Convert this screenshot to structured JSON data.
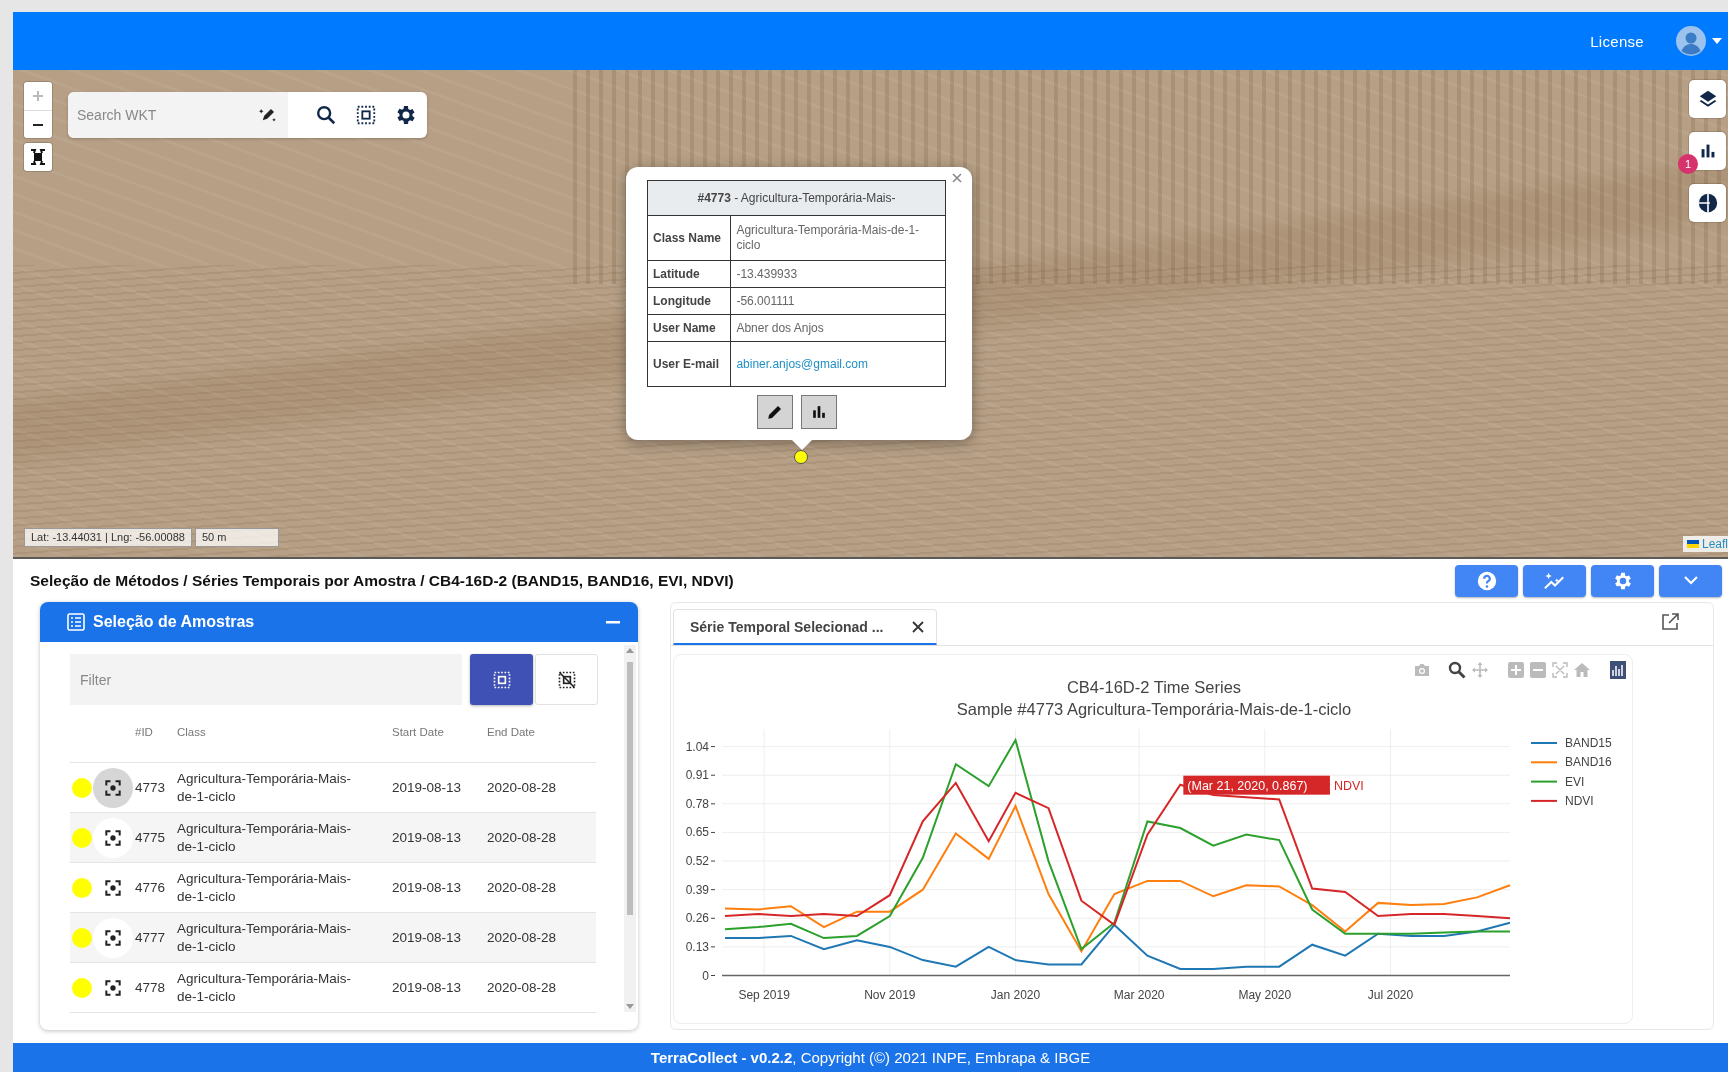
{
  "header": {
    "license_link": "License"
  },
  "map": {
    "search": {
      "placeholder": "Search WKT"
    },
    "zoom_in_disabled": true,
    "badge": "1",
    "popup": {
      "title": "**#4773** - Agricultura-Temporária-Mais-",
      "fields": [
        {
          "label": "Class Name",
          "value": "Agricultura-Temporária-Mais-de-1-ciclo",
          "kind": "text"
        },
        {
          "label": "Latitude",
          "value": "-13.439933",
          "kind": "text"
        },
        {
          "label": "Longitude",
          "value": "-56.001111",
          "kind": "text"
        },
        {
          "label": "User Name",
          "value": "Abner dos Anjos",
          "kind": "text"
        },
        {
          "label": "User E-mail",
          "value": "abiner.anjos@gmail.com",
          "kind": "link"
        }
      ]
    },
    "coordinates": "Lat: -13.44031 | Lng: -56.00088",
    "scale": "50 m",
    "attribution": "Leafl"
  },
  "breadcrumb": "Seleção de Métodos / Séries Temporais por Amostra / CB4-16D-2 (BAND15, BAND16, EVI, NDVI)",
  "samples": {
    "title": "Seleção de Amostras",
    "filter": {
      "placeholder": "Filter"
    },
    "columns": [
      "#ID",
      "Class",
      "Start Date",
      "End Date"
    ],
    "rows": [
      {
        "id": "4773",
        "class": "Agricultura-Temporária-Mais-de-1-ciclo",
        "start": "2019-08-13",
        "end": "2020-08-28",
        "color": "#ffff00",
        "selected": true
      },
      {
        "id": "4775",
        "class": "Agricultura-Temporária-Mais-de-1-ciclo",
        "start": "2019-08-13",
        "end": "2020-08-28",
        "color": "#ffff00",
        "selected": false
      },
      {
        "id": "4776",
        "class": "Agricultura-Temporária-Mais-de-1-ciclo",
        "start": "2019-08-13",
        "end": "2020-08-28",
        "color": "#ffff00",
        "selected": false
      },
      {
        "id": "4777",
        "class": "Agricultura-Temporária-Mais-de-1-ciclo",
        "start": "2019-08-13",
        "end": "2020-08-28",
        "color": "#ffff00",
        "selected": false
      },
      {
        "id": "4778",
        "class": "Agricultura-Temporária-Mais-de-1-ciclo",
        "start": "2019-08-13",
        "end": "2020-08-28",
        "color": "#ffff00",
        "selected": false
      }
    ]
  },
  "timeseries": {
    "tabs": [
      {
        "label": "Série Temporal Selecionad ...",
        "selected": true
      }
    ],
    "subtitle": "Sample #4773 Agricultura-Temporária-Mais-de-1-ciclo",
    "chart_data": {
      "type": "line",
      "title": "CB4-16D-2 Time Series",
      "x": [
        "2019-08-13",
        "2019-08-29",
        "2019-09-14",
        "2019-09-30",
        "2019-10-16",
        "2019-11-01",
        "2019-11-17",
        "2019-12-03",
        "2019-12-19",
        "2020-01-01",
        "2020-01-17",
        "2020-02-02",
        "2020-02-18",
        "2020-03-05",
        "2020-03-21",
        "2020-04-06",
        "2020-04-22",
        "2020-05-08",
        "2020-05-24",
        "2020-06-09",
        "2020-06-25",
        "2020-07-11",
        "2020-07-27",
        "2020-08-12",
        "2020-08-28"
      ],
      "series": [
        {
          "name": "BAND15",
          "color": "#1f77b4",
          "values": [
            0.17,
            0.17,
            0.18,
            0.12,
            0.16,
            0.13,
            0.07,
            0.04,
            0.13,
            0.07,
            0.05,
            0.05,
            0.23,
            0.09,
            0.03,
            0.03,
            0.04,
            0.04,
            0.14,
            0.09,
            0.19,
            0.18,
            0.18,
            0.2,
            0.24
          ]
        },
        {
          "name": "BAND16",
          "color": "#ff7f0e",
          "values": [
            0.305,
            0.3,
            0.315,
            0.22,
            0.29,
            0.29,
            0.39,
            0.645,
            0.53,
            0.77,
            0.37,
            0.11,
            0.37,
            0.43,
            0.43,
            0.36,
            0.41,
            0.405,
            0.32,
            0.2,
            0.33,
            0.32,
            0.325,
            0.355,
            0.41
          ]
        },
        {
          "name": "EVI",
          "color": "#2ca02c",
          "values": [
            0.21,
            0.22,
            0.235,
            0.17,
            0.18,
            0.27,
            0.535,
            0.96,
            0.86,
            1.07,
            0.52,
            0.12,
            0.24,
            0.7,
            0.67,
            0.59,
            0.64,
            0.615,
            0.3,
            0.19,
            0.19,
            0.19,
            0.195,
            0.2,
            0.2
          ]
        },
        {
          "name": "NDVI",
          "color": "#d62728",
          "values": [
            0.27,
            0.28,
            0.27,
            0.28,
            0.27,
            0.365,
            0.7,
            0.875,
            0.61,
            0.83,
            0.76,
            0.34,
            0.23,
            0.64,
            0.867,
            0.82,
            0.81,
            0.8,
            0.395,
            0.38,
            0.27,
            0.28,
            0.28,
            0.27,
            0.26
          ]
        }
      ],
      "xlim": [
        "2019-08-13",
        "2020-08-28"
      ],
      "ylim": [
        0,
        1.12
      ],
      "xticks": [
        {
          "value": "2019-09-01",
          "label": "Sep 2019"
        },
        {
          "value": "2019-11-01",
          "label": "Nov 2019"
        },
        {
          "value": "2020-01-01",
          "label": "Jan 2020"
        },
        {
          "value": "2020-03-01",
          "label": "Mar 2020"
        },
        {
          "value": "2020-05-01",
          "label": "May 2020"
        },
        {
          "value": "2020-07-01",
          "label": "Jul 2020"
        }
      ],
      "yticks": [
        0,
        0.13,
        0.26,
        0.39,
        0.52,
        0.65,
        0.78,
        0.91,
        1.04
      ],
      "grid": true,
      "legend": "right",
      "annotations": [
        {
          "x": "2020-03-21",
          "y": 0.867,
          "text": "(Mar 21, 2020, 0.867)"
        }
      ]
    },
    "hover_series": "NDVI"
  },
  "footer": "**TerraCollect - v0.2.2**, Copyright (©) 2021 INPE, Embrapa & IBGE"
}
